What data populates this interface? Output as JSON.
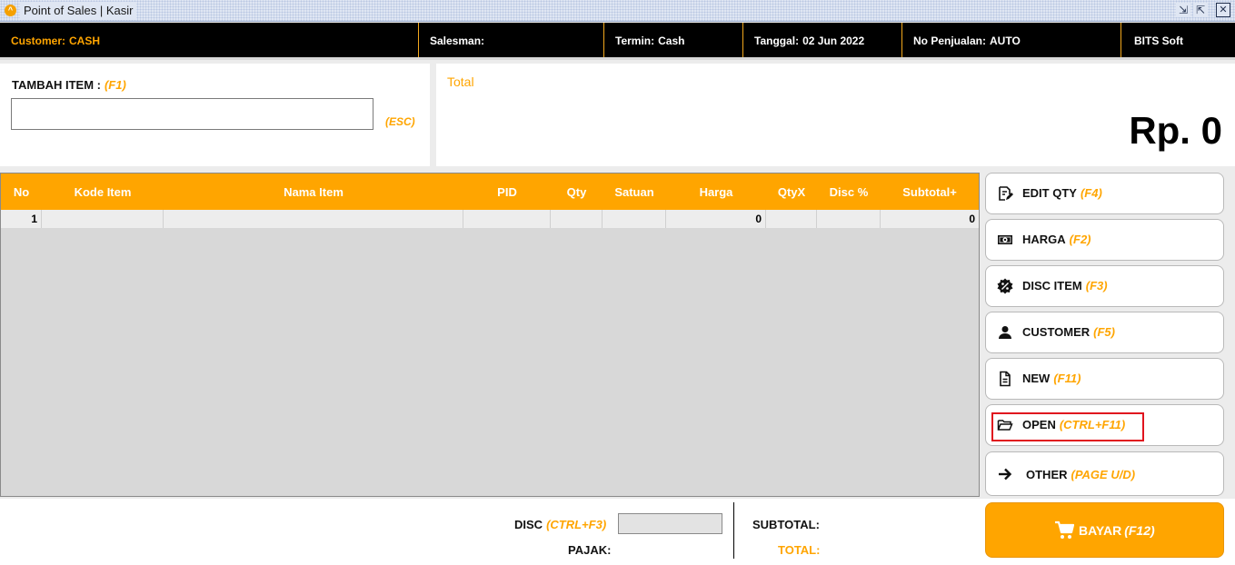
{
  "window": {
    "title": "Point of Sales | Kasir",
    "icon": "app-logo-icon",
    "controls": {
      "restore_down": "⇲",
      "restore_up": "⇱",
      "close": "✕"
    }
  },
  "header": {
    "customer_label": "Customer:",
    "customer_value": "CASH",
    "salesman_label": "Salesman:",
    "salesman_value": "",
    "termin_label": "Termin:",
    "termin_value": "Cash",
    "tanggal_label": "Tanggal:",
    "tanggal_value": "02 Jun 2022",
    "no_penjualan_label": "No Penjualan:",
    "no_penjualan_value": "AUTO",
    "brand": "BITS Soft"
  },
  "add_item": {
    "label": "TAMBAH ITEM :",
    "hotkey": "(F1)",
    "value": "",
    "esc_hint": "(ESC)"
  },
  "total_panel": {
    "label": "Total",
    "value": "Rp. 0"
  },
  "table": {
    "columns": [
      "No",
      "Kode Item",
      "Nama Item",
      "PID",
      "Qty",
      "Satuan",
      "Harga",
      "QtyX",
      "Disc %",
      "Subtotal+"
    ],
    "rows": [
      {
        "no": "1",
        "kode": "",
        "nama": "",
        "pid": "",
        "qty": "",
        "satuan": "",
        "harga": "0",
        "qtyx": "",
        "disc": "",
        "subtotal": "0"
      }
    ]
  },
  "actions": [
    {
      "label": "EDIT QTY",
      "hotkey": "(F4)",
      "icon": "edit-qty-icon"
    },
    {
      "label": "HARGA",
      "hotkey": "(F2)",
      "icon": "money-icon"
    },
    {
      "label": "DISC ITEM",
      "hotkey": "(F3)",
      "icon": "discount-badge-icon"
    },
    {
      "label": "CUSTOMER",
      "hotkey": "(F5)",
      "icon": "person-icon"
    },
    {
      "label": "NEW",
      "hotkey": "(F11)",
      "icon": "new-document-icon"
    },
    {
      "label": "OPEN",
      "hotkey": "(CTRL+F11)",
      "icon": "open-folder-icon",
      "highlighted": true
    },
    {
      "label": "OTHER",
      "hotkey": "(PAGE U/D)",
      "icon": "arrow-right-icon"
    }
  ],
  "pay_button": {
    "label": "BAYAR",
    "hotkey": "(F12)",
    "icon": "cart-icon"
  },
  "footer": {
    "disc_label": "DISC",
    "disc_hotkey": "(CTRL+F3)",
    "disc_value": "",
    "pajak_label": "PAJAK:",
    "subtotal_label": "SUBTOTAL:",
    "total_label": "TOTAL:"
  },
  "colors": {
    "accent": "#ffa500",
    "header_bg": "#000000",
    "highlight": "#e0141e"
  }
}
